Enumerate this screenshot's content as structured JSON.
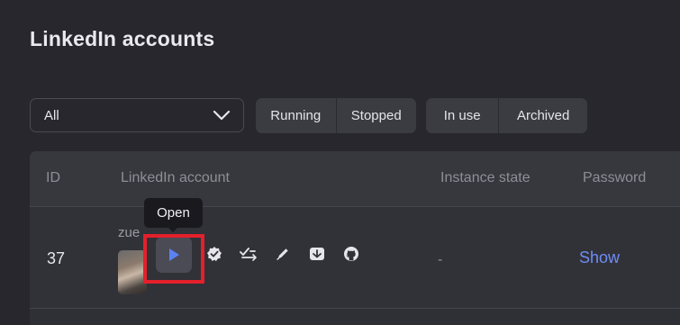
{
  "page": {
    "title": "LinkedIn accounts"
  },
  "filters": {
    "select_value": "All",
    "status_buttons": [
      "Running",
      "Stopped"
    ],
    "usage_buttons": [
      "In use",
      "Archived"
    ]
  },
  "table": {
    "headers": {
      "id": "ID",
      "account": "LinkedIn account",
      "instance_state": "Instance state",
      "password": "Password"
    },
    "rows": [
      {
        "id": "37",
        "account_name": "zue",
        "instance_state": "-",
        "password_action": "Show",
        "actions": [
          "play-icon",
          "badge-check-icon",
          "checklist-icon",
          "pencil-icon",
          "archive-icon",
          "github-icon"
        ]
      }
    ]
  },
  "tooltip": {
    "text": "Open"
  },
  "colors": {
    "background": "#28272e",
    "accent_link": "#6f8df5",
    "play_icon": "#5b82f2",
    "highlight_box": "#e3202b"
  }
}
